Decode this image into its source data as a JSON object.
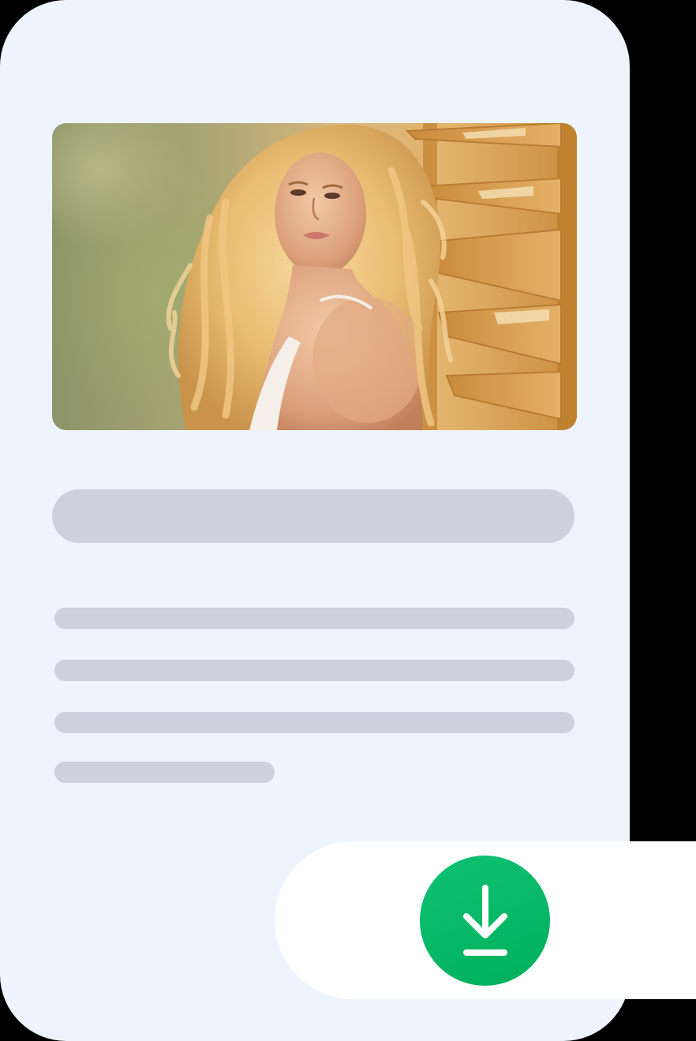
{
  "card": {
    "background": "#eef4fe"
  },
  "photo": {
    "subject": "woman-portrait-photo"
  },
  "skeleton": {
    "color": "#cbd1dd",
    "title_bar": "placeholder-title",
    "text_lines": [
      "placeholder-line-1",
      "placeholder-line-2",
      "placeholder-line-3",
      "placeholder-line-4"
    ]
  },
  "download": {
    "icon": "download-icon",
    "color": "#00b860"
  }
}
